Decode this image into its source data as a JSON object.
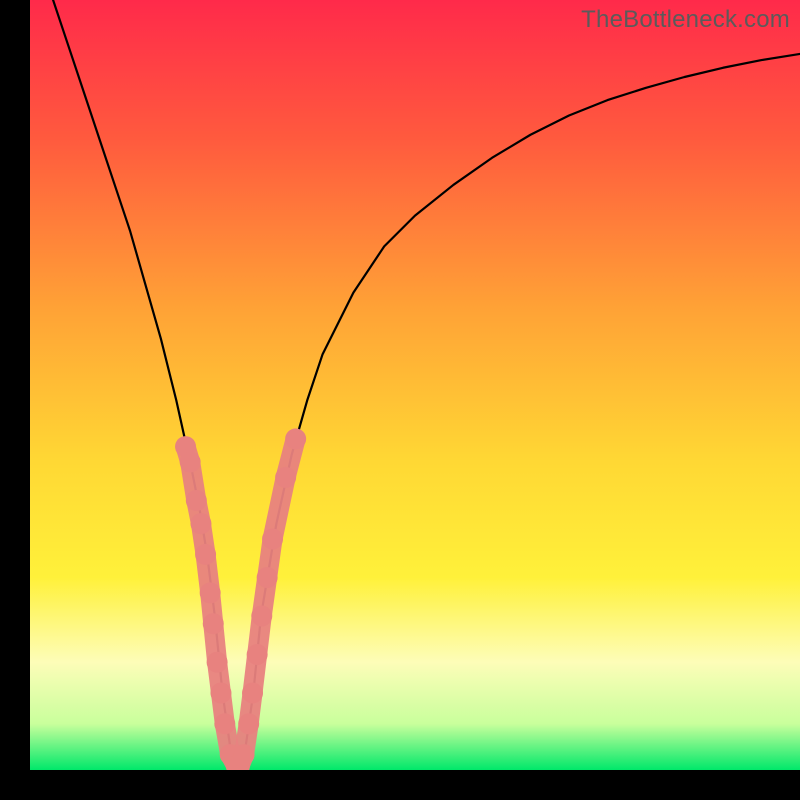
{
  "watermark": "TheBottleneck.com",
  "chart_data": {
    "type": "line",
    "title": "",
    "xlabel": "",
    "ylabel": "",
    "xlim": [
      0,
      100
    ],
    "ylim": [
      0,
      100
    ],
    "grid": false,
    "background_gradient": {
      "stops": [
        {
          "offset": 0.0,
          "color": "#ff2a4a"
        },
        {
          "offset": 0.18,
          "color": "#ff5a3e"
        },
        {
          "offset": 0.4,
          "color": "#ffa236"
        },
        {
          "offset": 0.6,
          "color": "#ffd834"
        },
        {
          "offset": 0.75,
          "color": "#fff13a"
        },
        {
          "offset": 0.86,
          "color": "#fdfdb8"
        },
        {
          "offset": 0.94,
          "color": "#c9ff9c"
        },
        {
          "offset": 1.0,
          "color": "#00e86a"
        }
      ]
    },
    "series": [
      {
        "name": "curve",
        "stroke": "#000000",
        "stroke_width": 2.2,
        "x": [
          3,
          5,
          7,
          9,
          11,
          13,
          15,
          17,
          19,
          21,
          22,
          23,
          24,
          25,
          26,
          27,
          28,
          29,
          30,
          32,
          34,
          36,
          38,
          42,
          46,
          50,
          55,
          60,
          65,
          70,
          75,
          80,
          85,
          90,
          95,
          100
        ],
        "y": [
          100,
          94,
          88,
          82,
          76,
          70,
          63,
          56,
          48,
          39,
          34,
          28,
          20,
          10,
          3,
          0,
          3,
          10,
          20,
          32,
          41,
          48,
          54,
          62,
          68,
          72,
          76,
          79.5,
          82.5,
          85,
          87,
          88.6,
          90,
          91.2,
          92.2,
          93
        ]
      }
    ],
    "marker_clusters": [
      {
        "name": "left-cluster",
        "color": "#e8827f",
        "points": [
          {
            "x": 20.2,
            "y": 42
          },
          {
            "x": 20.8,
            "y": 40
          },
          {
            "x": 21.6,
            "y": 35
          },
          {
            "x": 22.2,
            "y": 32
          },
          {
            "x": 22.8,
            "y": 28
          },
          {
            "x": 23.4,
            "y": 23
          },
          {
            "x": 23.8,
            "y": 19
          },
          {
            "x": 24.3,
            "y": 14
          },
          {
            "x": 24.8,
            "y": 10
          },
          {
            "x": 25.3,
            "y": 6
          },
          {
            "x": 26.0,
            "y": 2
          },
          {
            "x": 26.8,
            "y": 0.5
          }
        ]
      },
      {
        "name": "right-cluster",
        "color": "#e8827f",
        "points": [
          {
            "x": 27.2,
            "y": 0.5
          },
          {
            "x": 27.8,
            "y": 2
          },
          {
            "x": 28.4,
            "y": 6
          },
          {
            "x": 28.9,
            "y": 10
          },
          {
            "x": 29.5,
            "y": 15
          },
          {
            "x": 30.1,
            "y": 20
          },
          {
            "x": 30.8,
            "y": 25
          },
          {
            "x": 31.5,
            "y": 30
          },
          {
            "x": 33.2,
            "y": 38
          },
          {
            "x": 34.5,
            "y": 43
          }
        ]
      }
    ]
  }
}
